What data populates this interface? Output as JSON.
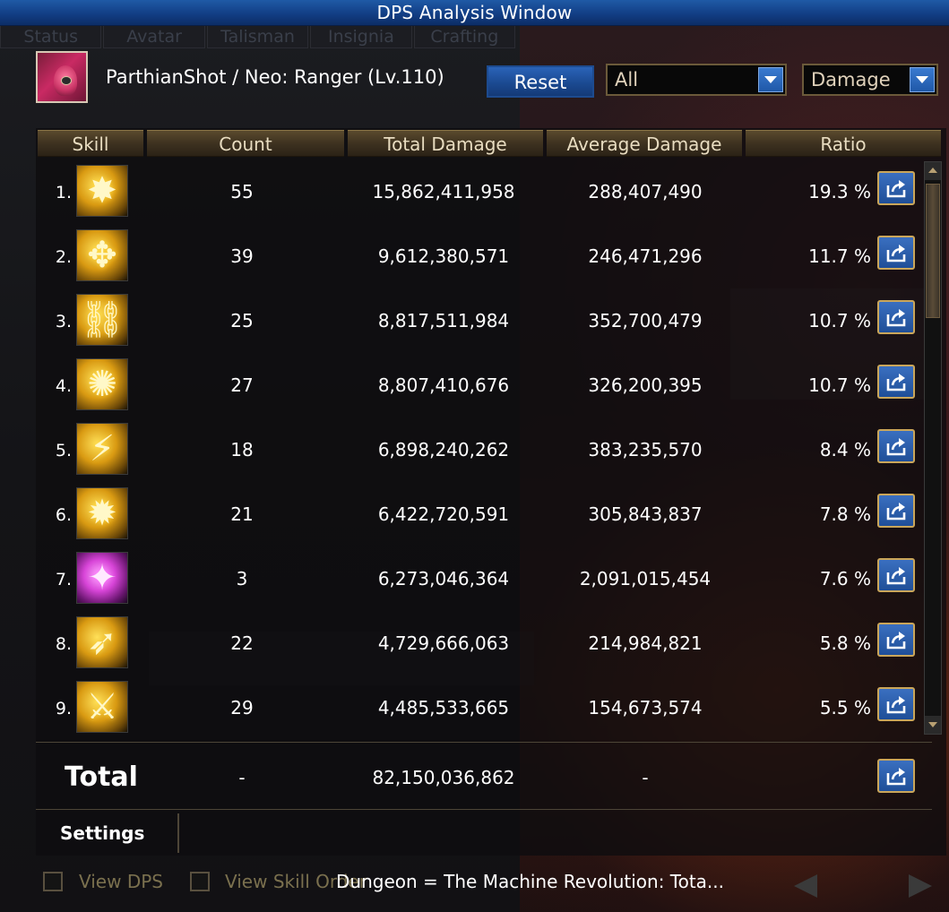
{
  "window": {
    "title": "DPS Analysis Window"
  },
  "background": {
    "tabs": [
      "Status",
      "Avatar",
      "Talisman",
      "Insignia",
      "Crafting"
    ]
  },
  "header": {
    "character": "ParthianShot / Neo: Ranger (Lv.110)",
    "reset_label": "Reset",
    "filter_value": "All",
    "metric_value": "Damage"
  },
  "columns": [
    "Skill",
    "Count",
    "Total Damage",
    "Average Damage",
    "Ratio"
  ],
  "rows": [
    {
      "rank": "1.",
      "icon": "starburst-skill-icon",
      "glyph": "✸",
      "count": "55",
      "total": "15,862,411,958",
      "avg": "288,407,490",
      "ratio": "19.3 %"
    },
    {
      "rank": "2.",
      "icon": "crosshair-skill-icon",
      "glyph": "✥",
      "count": "39",
      "total": "9,612,380,571",
      "avg": "246,471,296",
      "ratio": "11.7 %"
    },
    {
      "rank": "3.",
      "icon": "chains-skill-icon",
      "glyph": "⛓",
      "count": "25",
      "total": "8,817,511,984",
      "avg": "352,700,479",
      "ratio": "10.7 %"
    },
    {
      "rank": "4.",
      "icon": "spiral-shot-skill-icon",
      "glyph": "✺",
      "count": "27",
      "total": "8,807,410,676",
      "avg": "326,200,395",
      "ratio": "10.7 %"
    },
    {
      "rank": "5.",
      "icon": "slash-skill-icon",
      "glyph": "⚡",
      "count": "18",
      "total": "6,898,240,262",
      "avg": "383,235,570",
      "ratio": "8.4 %"
    },
    {
      "rank": "6.",
      "icon": "arrow-rain-skill-icon",
      "glyph": "✹",
      "count": "21",
      "total": "6,422,720,591",
      "avg": "305,843,837",
      "ratio": "7.8 %"
    },
    {
      "rank": "7.",
      "icon": "arcane-burst-skill-icon",
      "glyph": "✦",
      "count": "3",
      "total": "6,273,046,364",
      "avg": "2,091,015,454",
      "ratio": "7.6 %"
    },
    {
      "rank": "8.",
      "icon": "piercing-arrow-skill-icon",
      "glyph": "➶",
      "count": "22",
      "total": "4,729,666,063",
      "avg": "214,984,821",
      "ratio": "5.8 %"
    },
    {
      "rank": "9.",
      "icon": "leap-kick-skill-icon",
      "glyph": "⚔",
      "count": "29",
      "total": "4,485,533,665",
      "avg": "154,673,574",
      "ratio": "5.5 %"
    }
  ],
  "total": {
    "label": "Total",
    "count": "-",
    "damage": "82,150,036,862",
    "avg": "-"
  },
  "settings": {
    "label": "Settings"
  },
  "footer": {
    "view_dps_label": "View DPS",
    "view_skill_order_label": "View Skill Order",
    "dungeon_text": "Dungeon = The Machine Revolution: Tota..."
  },
  "colors": {
    "title_bar": "#1f5aa6",
    "header_gold": "#5a4a2e",
    "button_blue": "#2a63b8",
    "export_border": "#caa65a"
  }
}
